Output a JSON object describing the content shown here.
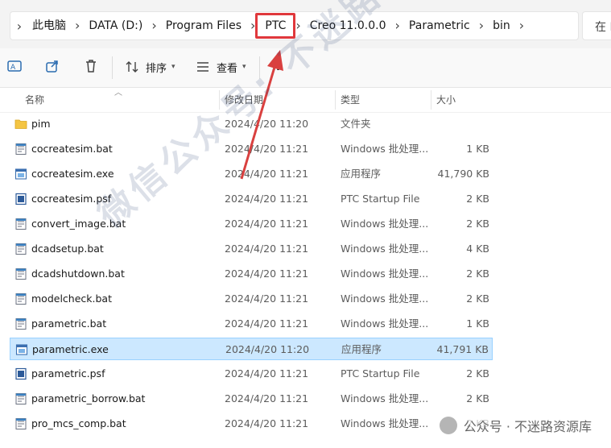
{
  "address_bar": {
    "crumbs": [
      "此电脑",
      "DATA (D:)",
      "Program Files",
      "PTC",
      "Creo 11.0.0.0",
      "Parametric",
      "bin"
    ],
    "highlighted_crumb": "PTC",
    "search_placeholder": "在 I"
  },
  "toolbar": {
    "sort_label": "排序",
    "view_label": "查看",
    "more_label": "..."
  },
  "columns": {
    "name": "名称",
    "date": "修改日期",
    "type": "类型",
    "size": "大小"
  },
  "files": [
    {
      "name": "pim",
      "date": "2024/4/20 11:20",
      "type": "文件夹",
      "size": "",
      "icon": "folder-icon"
    },
    {
      "name": "cocreatesim.bat",
      "date": "2024/4/20 11:21",
      "type": "Windows 批处理...",
      "size": "1 KB",
      "icon": "bat-file-icon"
    },
    {
      "name": "cocreatesim.exe",
      "date": "2024/4/20 11:21",
      "type": "应用程序",
      "size": "41,790 KB",
      "icon": "exe-file-icon"
    },
    {
      "name": "cocreatesim.psf",
      "date": "2024/4/20 11:21",
      "type": "PTC Startup File",
      "size": "2 KB",
      "icon": "psf-file-icon"
    },
    {
      "name": "convert_image.bat",
      "date": "2024/4/20 11:21",
      "type": "Windows 批处理...",
      "size": "2 KB",
      "icon": "bat-file-icon"
    },
    {
      "name": "dcadsetup.bat",
      "date": "2024/4/20 11:21",
      "type": "Windows 批处理...",
      "size": "4 KB",
      "icon": "bat-file-icon"
    },
    {
      "name": "dcadshutdown.bat",
      "date": "2024/4/20 11:21",
      "type": "Windows 批处理...",
      "size": "2 KB",
      "icon": "bat-file-icon"
    },
    {
      "name": "modelcheck.bat",
      "date": "2024/4/20 11:21",
      "type": "Windows 批处理...",
      "size": "2 KB",
      "icon": "bat-file-icon"
    },
    {
      "name": "parametric.bat",
      "date": "2024/4/20 11:21",
      "type": "Windows 批处理...",
      "size": "1 KB",
      "icon": "bat-file-icon"
    },
    {
      "name": "parametric.exe",
      "date": "2024/4/20 11:20",
      "type": "应用程序",
      "size": "41,791 KB",
      "icon": "exe-file-icon",
      "selected": true
    },
    {
      "name": "parametric.psf",
      "date": "2024/4/20 11:21",
      "type": "PTC Startup File",
      "size": "2 KB",
      "icon": "psf-file-icon"
    },
    {
      "name": "parametric_borrow.bat",
      "date": "2024/4/20 11:21",
      "type": "Windows 批处理...",
      "size": "2 KB",
      "icon": "bat-file-icon"
    },
    {
      "name": "pro_mcs_comp.bat",
      "date": "2024/4/20 11:21",
      "type": "Windows 批处理...",
      "size": "2 KB",
      "icon": "bat-file-icon"
    }
  ],
  "watermark_text": "微信公众号: 不迷路资源库",
  "watermark_footer": "公众号 · 不迷路资源库",
  "colors": {
    "highlight_box": "#e0383c",
    "arrow": "#d9403f",
    "selection_bg": "#cce8ff",
    "folder": "#f4c543"
  }
}
